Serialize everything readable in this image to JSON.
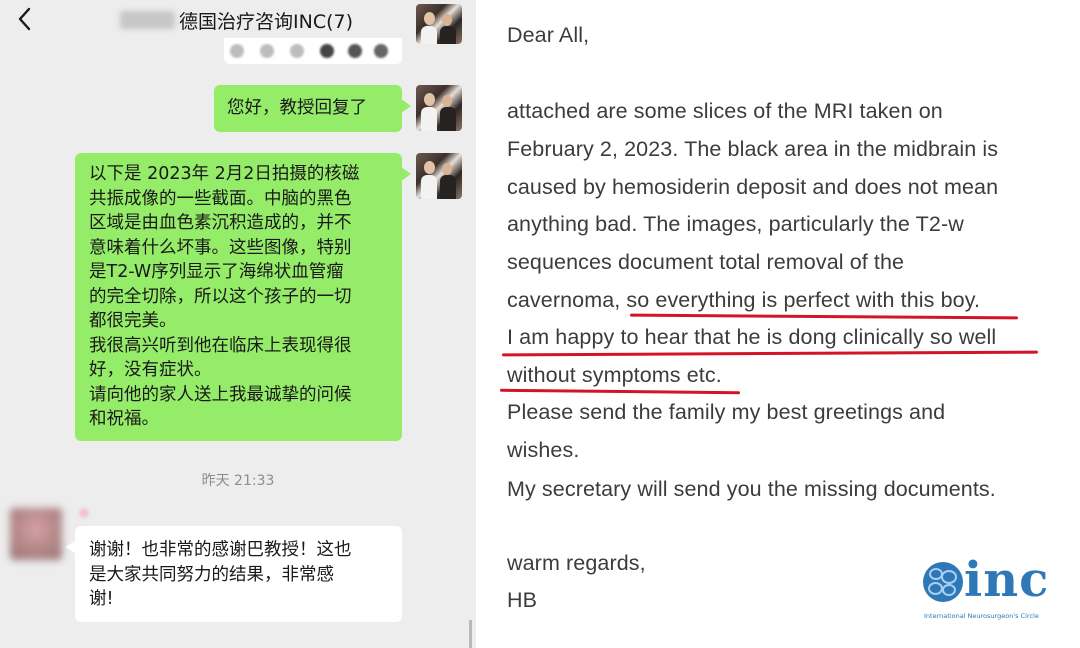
{
  "chat": {
    "title": "德国治疗咨询INC(7)",
    "message_outgoing_1": "您好，教授回复了",
    "message_outgoing_2": [
      "以下是 2023年 2月2日拍摄的核磁",
      "共振成像的一些截面。中脑的黑色",
      "区域是由血色素沉积造成的，并不",
      "意味着什么坏事。这些图像，特别",
      "是T2-W序列显示了海绵状血管瘤",
      "的完全切除，所以这个孩子的一切",
      "都很完美。",
      "我很高兴听到他在临床上表现得很",
      "好，没有症状。",
      "请向他的家人送上我最诚挚的问候",
      "和祝福。"
    ],
    "timestamp": "昨天 21:33",
    "message_incoming_1": [
      "谢谢！也非常的感谢巴教授！这也",
      "是大家共同努力的结果，非常感",
      "谢!"
    ],
    "icons": {
      "back": "chevron-left-icon",
      "more": "more-dots-icon"
    },
    "colors": {
      "background": "#ededed",
      "outgoing_bubble": "#95ec69",
      "incoming_bubble": "#ffffff"
    }
  },
  "email": {
    "lines": [
      "Dear All,",
      "attached are some slices of the MRI taken on",
      "February 2, 2023. The black area in the midbrain is",
      "caused by hemosiderin deposit and does not mean",
      "anything bad. The images, particularly the T2-w",
      "sequences document total removal of the",
      "cavernoma, so everything is perfect with this boy.",
      "I am happy to hear that he is dong clinically so well",
      "without symptoms etc.",
      "Please send the family my best greetings and",
      "wishes.",
      "My secretary will send you the missing documents.",
      "warm regards,",
      "HB"
    ],
    "underline_color": "#d21428",
    "logo": {
      "text": "inc",
      "subtitle": "International Neurosurgeon's Circle",
      "color": "#2e78b8"
    }
  }
}
